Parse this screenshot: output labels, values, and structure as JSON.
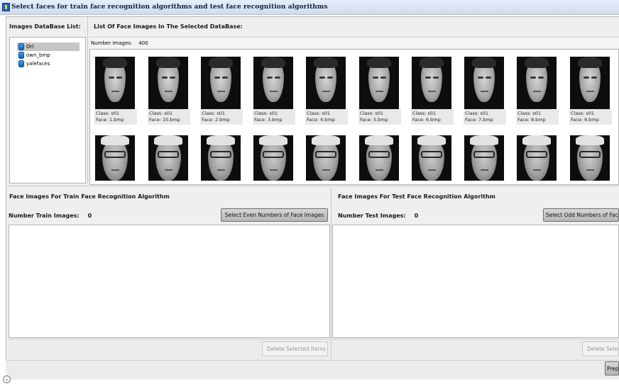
{
  "window": {
    "title": "Select faces for train face recognition algorithms and test face recognition algorithms"
  },
  "db_panel": {
    "header": "Images DataBase List:",
    "items": [
      {
        "label": "Orl",
        "selected": true
      },
      {
        "label": "own_bmp",
        "selected": false
      },
      {
        "label": "yalefaces",
        "selected": false
      }
    ]
  },
  "faces_panel": {
    "header": "List Of Face Images In The Selected DataBase:",
    "count_label": "Number Images:",
    "count_value": "400",
    "row1": [
      {
        "class": "Class: s01",
        "face": "Face: 1.bmp"
      },
      {
        "class": "Class: s01",
        "face": "Face: 10.bmp"
      },
      {
        "class": "Class: s01",
        "face": "Face: 2.bmp"
      },
      {
        "class": "Class: s01",
        "face": "Face: 3.bmp"
      },
      {
        "class": "Class: s01",
        "face": "Face: 4.bmp"
      },
      {
        "class": "Class: s01",
        "face": "Face: 5.bmp"
      },
      {
        "class": "Class: s01",
        "face": "Face: 6.bmp"
      },
      {
        "class": "Class: s01",
        "face": "Face: 7.bmp"
      },
      {
        "class": "Class: s01",
        "face": "Face: 8.bmp"
      },
      {
        "class": "Class: s01",
        "face": "Face: 9.bmp"
      }
    ]
  },
  "train": {
    "title": "Face Images For Train Face Recognition Algorithm",
    "count_label": "Number Train Images:",
    "count_value": "0",
    "select_button": "Select Even Numbers of Face Images",
    "delete_button": "Delete Selected Items"
  },
  "test": {
    "title": "Face Images For Test Face Recognition Algorithm",
    "count_label": "Number Test Images:",
    "count_value": "0",
    "select_button": "Select Odd Numbers of Fac",
    "delete_button": "Delete Selec"
  },
  "footer": {
    "prep_button": "Prep"
  },
  "icons": {
    "db": "database-icon",
    "expand": "chevron-down-icon",
    "app": "app-icon"
  },
  "colors": {
    "db_icon": "#2a86d6",
    "selected_row": "#c5c5c5"
  }
}
